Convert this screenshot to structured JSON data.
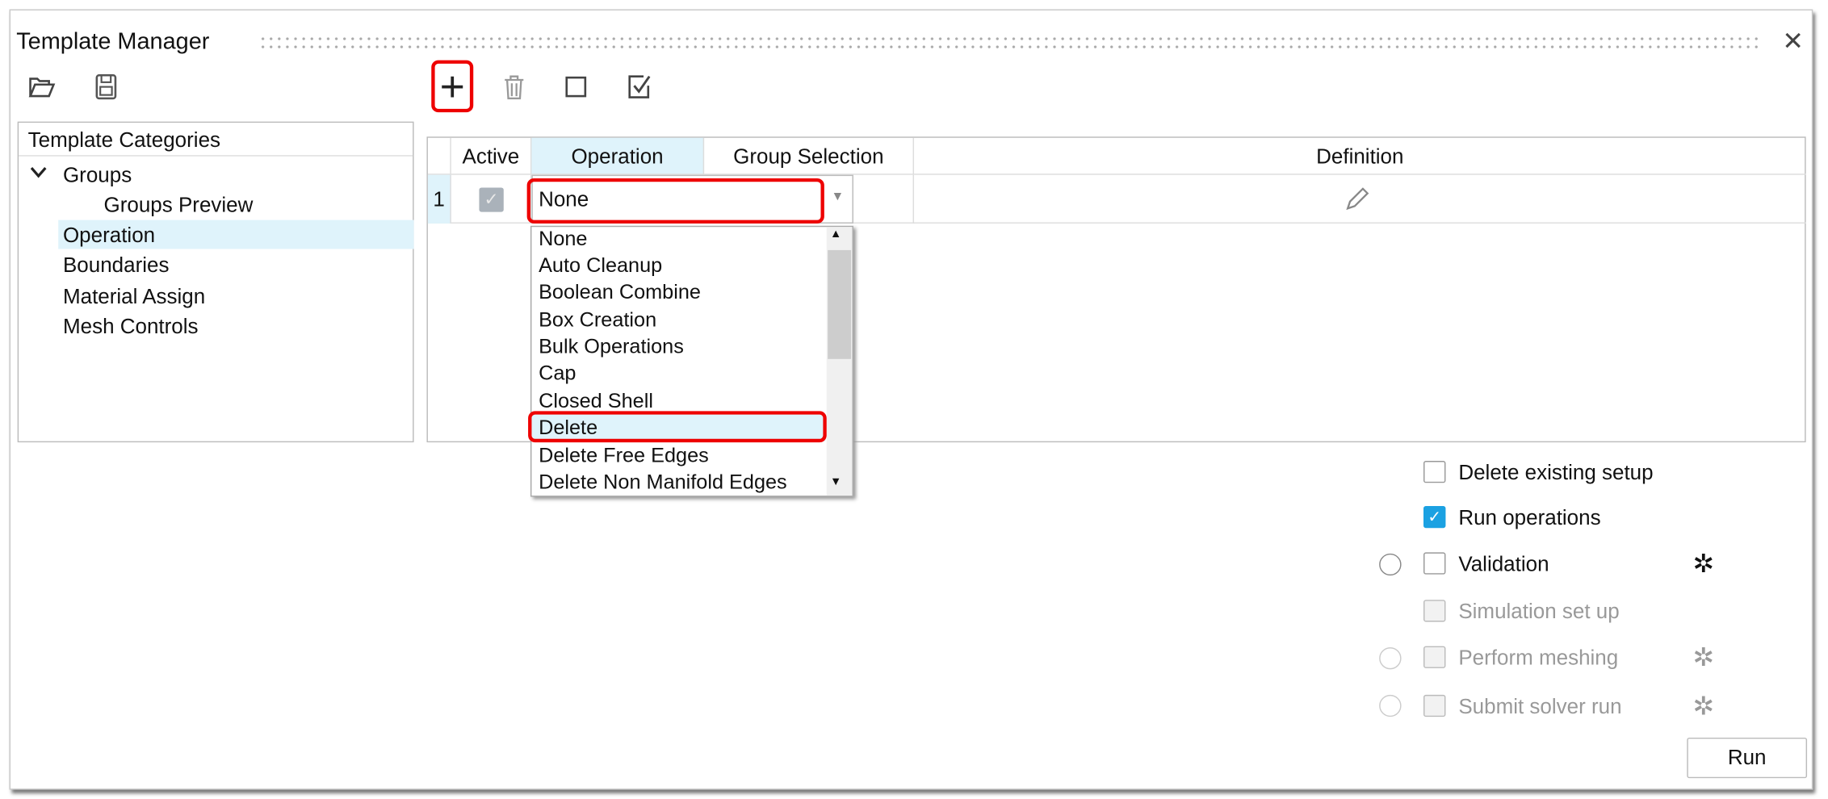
{
  "window": {
    "title": "Template Manager",
    "close_icon": "close-icon"
  },
  "toolbar": {
    "icons": [
      "open-folder-icon",
      "save-icon",
      "add-icon",
      "delete-icon",
      "uncheck-all-icon",
      "check-all-icon"
    ]
  },
  "categories": {
    "header": "Template Categories",
    "items": [
      {
        "label": "Groups",
        "expanded": true
      },
      {
        "label": "Groups Preview"
      },
      {
        "label": "Operation",
        "selected": true
      },
      {
        "label": "Boundaries"
      },
      {
        "label": "Material Assign"
      },
      {
        "label": "Mesh Controls"
      }
    ]
  },
  "table": {
    "columns": [
      "Active",
      "Operation",
      "Group Selection",
      "Definition"
    ],
    "rows": [
      {
        "index": "1",
        "active": true,
        "operation": "None",
        "group_selection": ""
      }
    ]
  },
  "dropdown": {
    "options": [
      "None",
      "Auto Cleanup",
      "Boolean Combine",
      "Box Creation",
      "Bulk Operations",
      "Cap",
      "Closed Shell",
      "Delete",
      "Delete Free Edges",
      "Delete Non Manifold Edges"
    ],
    "highlighted": "Delete"
  },
  "options": [
    {
      "label": "Delete existing setup",
      "checked": false,
      "enabled": true
    },
    {
      "label": "Run operations",
      "checked": true,
      "enabled": true
    },
    {
      "label": "Validation",
      "checked": false,
      "enabled": true
    },
    {
      "label": "Simulation set up",
      "checked": false,
      "enabled": false
    },
    {
      "label": "Perform meshing",
      "checked": false,
      "enabled": false
    },
    {
      "label": "Submit solver run",
      "checked": false,
      "enabled": false
    }
  ],
  "run_label": "Run",
  "colors": {
    "accent": "#1ba1e2",
    "highlight": "#dff3fb",
    "annotation": "#e00000"
  }
}
